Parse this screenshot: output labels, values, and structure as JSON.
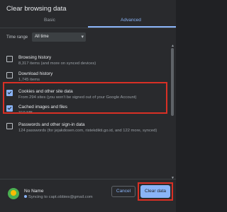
{
  "dialog": {
    "title": "Clear browsing data",
    "tabs": [
      {
        "label": "Basic"
      },
      {
        "label": "Advanced"
      }
    ],
    "time_range_label": "Time range",
    "time_range_value": "All time",
    "items": [
      {
        "title": "Browsing history",
        "subtitle": "8,317 items (and more on synced devices)",
        "checked": false
      },
      {
        "title": "Download history",
        "subtitle": "1,745 items",
        "checked": false
      },
      {
        "title": "Cookies and other site data",
        "subtitle": "From 294 sites (you won't be signed out of your Google Account)",
        "checked": true
      },
      {
        "title": "Cached images and files",
        "subtitle": "319 MB",
        "checked": true
      },
      {
        "title": "Passwords and other sign-in data",
        "subtitle": "124 passwords (for jejakdosen.com, ristekdikti.go.id, and 122 more, synced)",
        "checked": false
      }
    ],
    "buttons": {
      "cancel": "Cancel",
      "clear": "Clear data"
    },
    "account": {
      "name": "No Name",
      "sync_text": "Syncing to capt.obbies@gmail.com"
    },
    "colors": {
      "accent": "#8ab4f8",
      "highlight": "#d93025",
      "background": "#292a2d"
    }
  }
}
